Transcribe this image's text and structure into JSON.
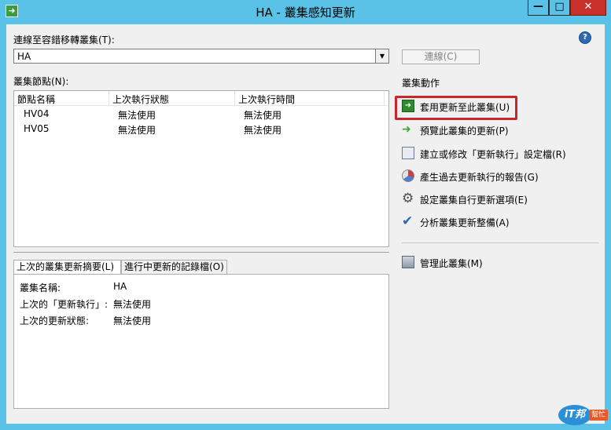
{
  "window": {
    "title": "HA - 叢集感知更新",
    "min_glyph": "—",
    "max_glyph": "□",
    "close_glyph": "✕"
  },
  "connect": {
    "label": "連線至容錯移轉叢集(T):",
    "cluster_value": "HA",
    "connect_button": "連線(C)"
  },
  "nodes": {
    "label": "叢集節點(N):",
    "columns": [
      "節點名稱",
      "上次執行狀態",
      "上次執行時間"
    ],
    "rows": [
      [
        "HV04",
        "無法使用",
        "無法使用"
      ],
      [
        "HV05",
        "無法使用",
        "無法使用"
      ]
    ]
  },
  "tabs": [
    {
      "label": "上次的叢集更新摘要(L)",
      "active": true
    },
    {
      "label": "進行中更新的記錄檔(O)",
      "active": false
    }
  ],
  "summary": {
    "rows": [
      {
        "label": "叢集名稱:",
        "value": "HA"
      },
      {
        "label": "上次的「更新執行」:",
        "value": "無法使用"
      },
      {
        "label": "上次的更新狀態:",
        "value": "無法使用"
      }
    ]
  },
  "actions": {
    "heading": "叢集動作",
    "items": [
      {
        "label": "套用更新至此叢集(U)",
        "icon": "apply-updates-icon",
        "highlighted": true
      },
      {
        "label": "預覽此叢集的更新(P)",
        "icon": "preview-arrow-icon"
      },
      {
        "label": "建立或修改「更新執行」設定檔(R)",
        "icon": "profile-document-icon"
      },
      {
        "label": "產生過去更新執行的報告(G)",
        "icon": "report-pie-icon"
      },
      {
        "label": "設定叢集自行更新選項(E)",
        "icon": "gear-icon"
      },
      {
        "label": "分析叢集更新整備(A)",
        "icon": "checkmark-icon"
      },
      {
        "label": "管理此叢集(M)",
        "icon": "server-icon"
      }
    ]
  },
  "watermark": {
    "brand": "iT邦",
    "tag": "幫忙"
  },
  "colors": {
    "title_bar": "#5bc2e7",
    "close_button": "#c7312a",
    "highlight_border": "#c8262b",
    "client_bg": "#f0f0f0"
  }
}
